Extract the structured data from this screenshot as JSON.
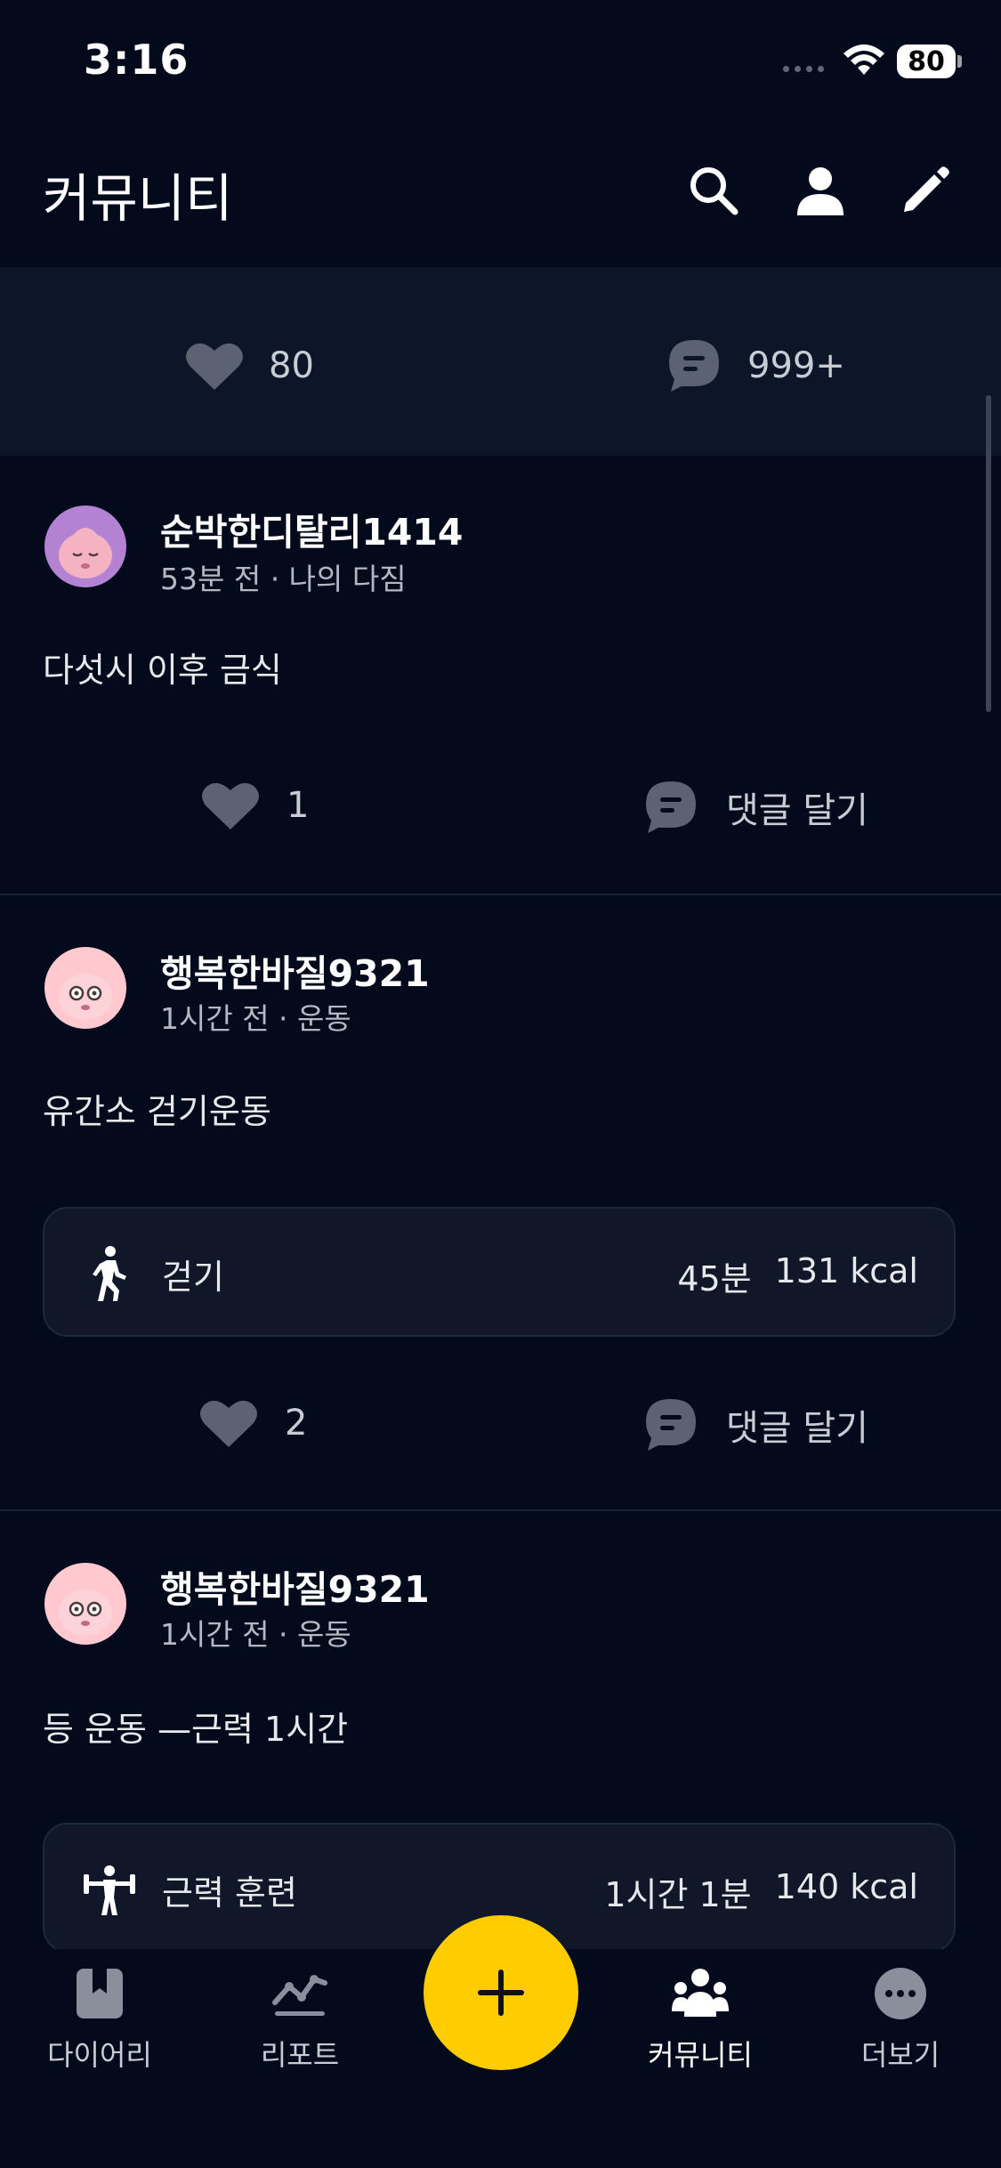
{
  "status_bar": {
    "time": "3:16",
    "battery": "80"
  },
  "header": {
    "title": "커뮤니티"
  },
  "summary": {
    "likes": "80",
    "comments": "999+"
  },
  "posts": [
    {
      "username": "순박한디탈리1414",
      "meta": "53분 전 · 나의 다짐",
      "text": "다섯시 이후 금식",
      "likes": "1",
      "comment_label": "댓글 달기"
    },
    {
      "username": "행복한바질9321",
      "meta": "1시간 전 · 운동",
      "text": "유간소 걷기운동",
      "workout": {
        "icon": "walking-icon",
        "label": "걷기",
        "duration": "45분",
        "kcal": "131 kcal"
      },
      "likes": "2",
      "comment_label": "댓글 달기"
    },
    {
      "username": "행복한바질9321",
      "meta": "1시간 전 · 운동",
      "text": "등 운동 —근력 1시간",
      "workout": {
        "icon": "weightlifting-icon",
        "label": "근력 훈련",
        "duration": "1시간 1분",
        "kcal": "140 kcal"
      }
    }
  ],
  "nav": {
    "items": [
      {
        "label": "다이어리",
        "icon": "diary-icon"
      },
      {
        "label": "리포트",
        "icon": "report-icon"
      },
      {
        "label": "커뮤니티",
        "icon": "community-icon",
        "active": true
      },
      {
        "label": "더보기",
        "icon": "more-icon"
      }
    ]
  },
  "colors": {
    "background": "#030a1c",
    "accent": "#ffcc00",
    "icon_gray": "#5d6272"
  }
}
